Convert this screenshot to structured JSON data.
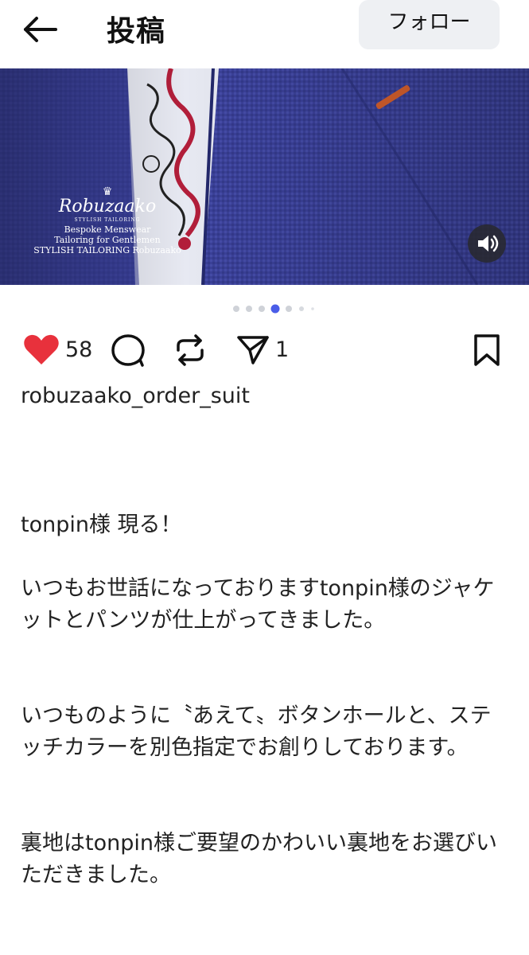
{
  "header": {
    "back_icon": "arrow-left-icon",
    "title": "投稿",
    "follow_label": "フォロー"
  },
  "hero": {
    "brand_crown": "♛",
    "brand_name": "Robuzaako",
    "brand_sub": "STYLISH TAILORING",
    "brand_lines": [
      "Bespoke Menswear",
      "Tailoring for Gentlemen",
      "STYLISH TAILORING Robuzaako"
    ],
    "sound_icon": "speaker-icon",
    "carousel_total": 7,
    "carousel_active": 4
  },
  "actions": {
    "like_icon": "heart-icon",
    "like_count": "58",
    "comment_icon": "comment-icon",
    "repost_icon": "repost-icon",
    "share_icon": "send-icon",
    "share_count": "1",
    "bookmark_icon": "bookmark-icon"
  },
  "post": {
    "username": "robuzaako_order_suit",
    "caption": [
      "tonpin様 現る！",
      "いつもお世話になっておりますtonpin様のジャケットとパンツが仕上がってきました。",
      "いつものように〝あえて〟ボタンホールと、ステッチカラーを別色指定でお創りしております。",
      "裏地はtonpin様ご要望のかわいい裏地をお選びいただきました。"
    ]
  },
  "colors": {
    "like": "#e8313c",
    "fabric": "#3a3f96",
    "accent_dot": "#4a5de8"
  }
}
